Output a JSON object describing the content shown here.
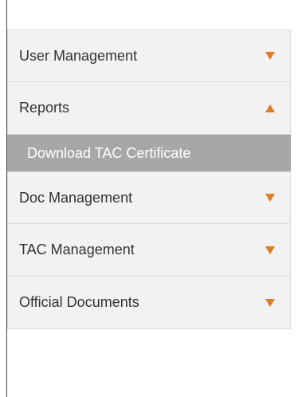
{
  "sidebar": {
    "accent_color": "#e07b1f",
    "items": [
      {
        "label": "User Management",
        "arrow": "down"
      },
      {
        "label": "Reports",
        "arrow": "up",
        "expanded": true,
        "subitems": [
          {
            "label": "Download TAC Certificate"
          }
        ]
      },
      {
        "label": "Doc Management",
        "arrow": "down"
      },
      {
        "label": "TAC Management",
        "arrow": "down"
      },
      {
        "label": "Official Documents",
        "arrow": "down"
      }
    ]
  }
}
